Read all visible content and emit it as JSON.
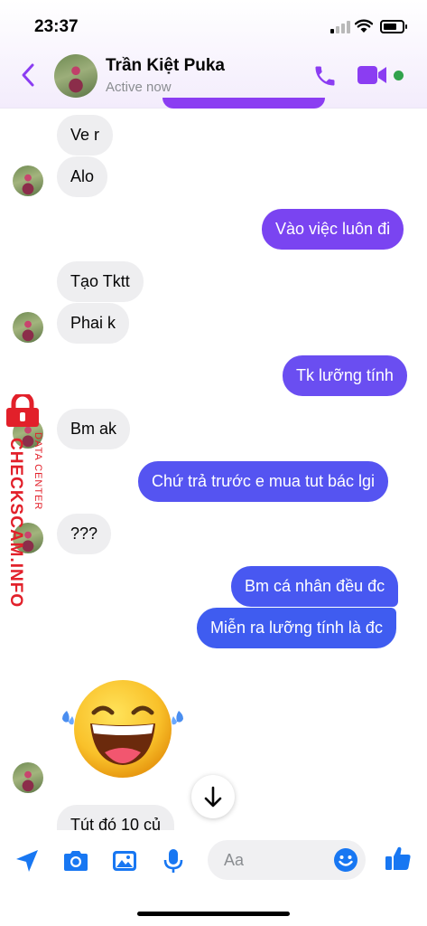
{
  "status_bar": {
    "time": "23:37"
  },
  "header": {
    "contact_name": "Trần Kiệt Puka",
    "status": "Active now"
  },
  "icons": {
    "back": "chevron-left-icon",
    "call": "phone-icon",
    "video": "video-camera-icon",
    "scroll": "arrow-down-icon",
    "composer": [
      "location-arrow-icon",
      "camera-icon",
      "image-icon",
      "microphone-icon",
      "emoji-icon",
      "thumbs-up-icon"
    ]
  },
  "messages": [
    {
      "from": "them",
      "text": "Ve r"
    },
    {
      "from": "them",
      "text": "Alo"
    },
    {
      "from": "me",
      "text": "Vào việc luôn đi"
    },
    {
      "from": "them",
      "text": "Tạo Tktt"
    },
    {
      "from": "them",
      "text": "Phai k"
    },
    {
      "from": "me",
      "text": "Tk lưỡng tính"
    },
    {
      "from": "them",
      "text": "Bm ak"
    },
    {
      "from": "me",
      "text": "Chứ trả trước e mua tut bác lgi"
    },
    {
      "from": "them",
      "text": "???"
    },
    {
      "from": "me",
      "text": "Bm cá nhân đều đc"
    },
    {
      "from": "me",
      "text": "Miễn ra lưỡng tính là đc"
    },
    {
      "from": "them",
      "sticker": "laughing-tears-emoji"
    },
    {
      "from": "them",
      "text": "Tút đó 10 củ"
    }
  ],
  "composer": {
    "placeholder": "Aa"
  },
  "watermark": {
    "main": "CHECKSCAM.INFO",
    "sub": "DATA CENTER"
  },
  "colors": {
    "accent": "#8b3df2",
    "outgoing_top": "#8a3ff1",
    "outgoing_bottom": "#3d5df0",
    "incoming": "#eeeef0",
    "composer_icons": "#1877f2",
    "online": "#31a24c",
    "watermark": "#e2202a"
  }
}
